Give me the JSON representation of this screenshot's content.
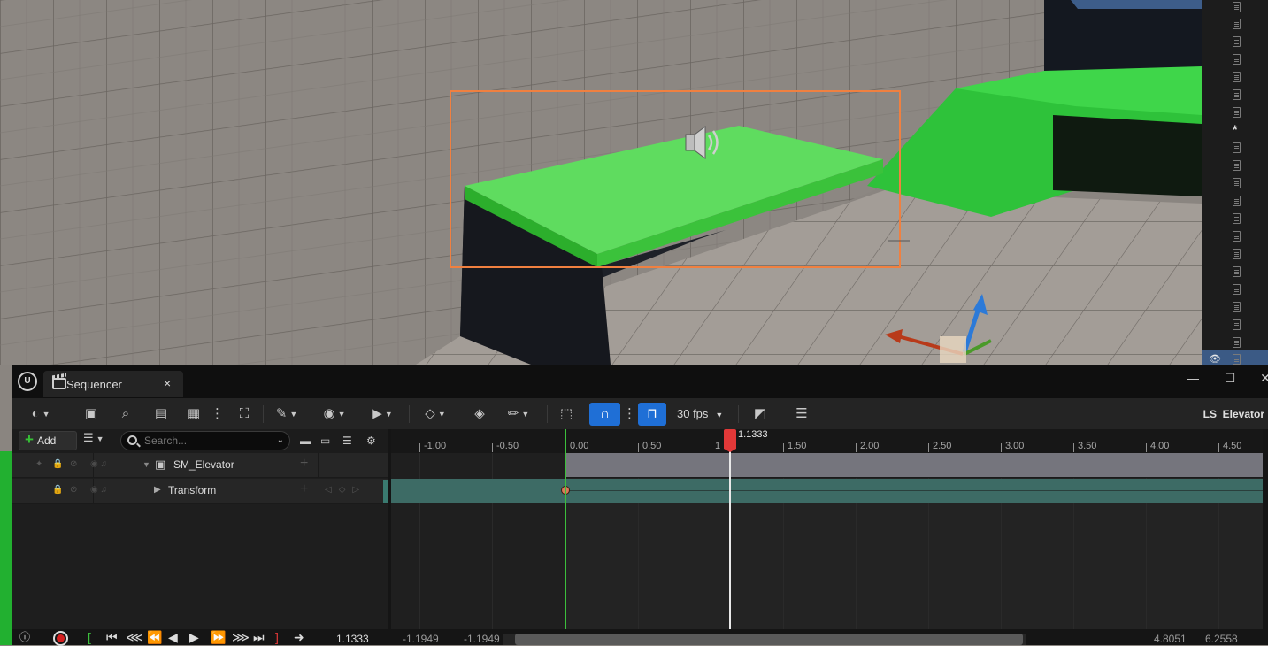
{
  "viewport": {
    "colors": {
      "wall": "#8c8782",
      "floor": "#9a948e",
      "platform": "#5fdc5f",
      "selection": "#f08040",
      "ramp": "#2ec23a"
    }
  },
  "sequencer": {
    "tab": {
      "label": "Sequencer",
      "close": "×"
    },
    "window_controls": {
      "minimize": "—",
      "maximize": "☐",
      "close": "✕"
    },
    "toolbar": {
      "fps": "30 fps",
      "sequence_name": "LS_Elevator",
      "snap_active": true
    },
    "tracklist": {
      "add_label": "Add",
      "search_placeholder": "Search...",
      "tracks": [
        {
          "name": "SM_Elevator",
          "type": "actor",
          "expanded": true
        },
        {
          "name": "Transform",
          "type": "transform",
          "expanded": false
        }
      ]
    },
    "ruler": {
      "ticks": [
        "-1.00",
        "-0.50",
        "0.00",
        "0.50",
        "1",
        "1.50",
        "2.00",
        "2.50",
        "3.00",
        "3.50",
        "4.00",
        "4.50"
      ]
    },
    "playhead": {
      "time": "1.1333"
    },
    "transport": {
      "current_time": "1.1333",
      "view_start": "-1.1949",
      "view_start_2": "-1.1949",
      "view_end": "4.8051",
      "view_end_2": "6.2558"
    }
  }
}
